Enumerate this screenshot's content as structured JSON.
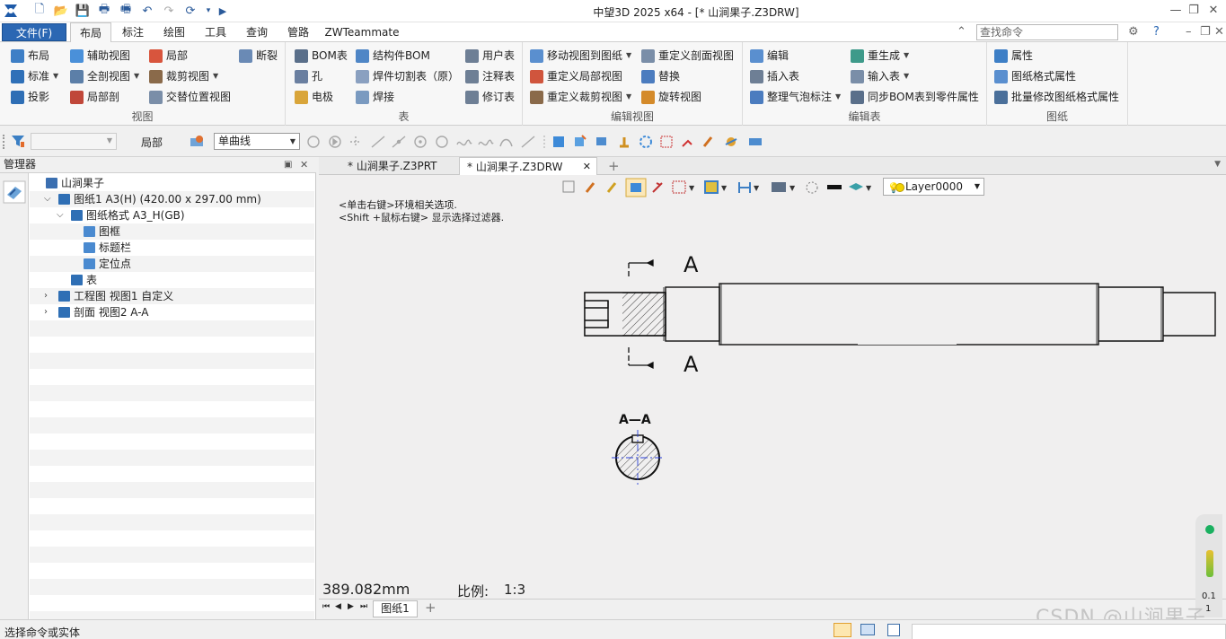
{
  "app": {
    "title": "中望3D 2025 x64 - [* 山涧果子.Z3DRW]"
  },
  "menu": {
    "file": "文件(F)",
    "tabs": [
      "布局",
      "标注",
      "绘图",
      "工具",
      "查询",
      "管路",
      "ZWTeammate"
    ],
    "search_placeholder": "查找命令"
  },
  "ribbon": {
    "view": {
      "label": "视图",
      "items": [
        "布局",
        "辅助视图",
        "局部",
        "断裂",
        "标准",
        "全剖视图",
        "裁剪视图",
        "投影",
        "局部剖",
        "交替位置视图"
      ]
    },
    "table": {
      "label": "表",
      "items": [
        "BOM表",
        "结构件BOM",
        "用户表",
        "孔",
        "焊件切割表（原）",
        "注释表",
        "电极",
        "焊接",
        "修订表"
      ]
    },
    "edit_view": {
      "label": "编辑视图",
      "items": [
        "移动视图到图纸",
        "重定义剖面视图",
        "重定义局部视图",
        "替换",
        "重定义裁剪视图",
        "旋转视图"
      ]
    },
    "edit_table": {
      "label": "编辑表",
      "items": [
        "编辑",
        "重生成",
        "插入表",
        "输入表",
        "整理气泡标注",
        "同步BOM表到零件属性"
      ]
    },
    "sheet": {
      "label": "图纸",
      "items": [
        "属性",
        "图纸格式属性",
        "批量修改图纸格式属性"
      ]
    }
  },
  "toolbar2": {
    "filter_value": "局部",
    "curve_select": "单曲线"
  },
  "manager": {
    "title": "管理器",
    "tree": [
      {
        "label": "山涧果子",
        "level": 0,
        "expand": ""
      },
      {
        "label": "图纸1 A3(H) (420.00 x 297.00 mm)",
        "level": 1,
        "expand": "v"
      },
      {
        "label": "图纸格式 A3_H(GB)",
        "level": 2,
        "expand": "v"
      },
      {
        "label": "图框",
        "level": 3,
        "expand": ""
      },
      {
        "label": "标题栏",
        "level": 3,
        "expand": ""
      },
      {
        "label": "定位点",
        "level": 3,
        "expand": ""
      },
      {
        "label": "表",
        "level": 2,
        "expand": ""
      },
      {
        "label": "工程图 视图1 自定义",
        "level": 1,
        "expand": ">"
      },
      {
        "label": "剖面 视图2 A-A",
        "level": 1,
        "expand": ">"
      }
    ]
  },
  "doc_tabs": [
    "* 山涧果子.Z3PRT",
    "* 山涧果子.Z3DRW"
  ],
  "canvas": {
    "hint1": "<单击右键>环境相关选项.",
    "hint2": "<Shift +鼠标右键> 显示选择过滤器.",
    "measure": "389.082mm",
    "scale_label": "比例:",
    "scale_value": "1:3",
    "layer": "Layer0000",
    "section_label_top": "A",
    "section_label_bottom": "A",
    "section_view_label": "A—A"
  },
  "sheet_tab": "图纸1",
  "status": {
    "text": "选择命令或实体",
    "watermark": "CSDN @山涧果子"
  },
  "dock": {
    "value1": "0.1",
    "value2": "1"
  }
}
